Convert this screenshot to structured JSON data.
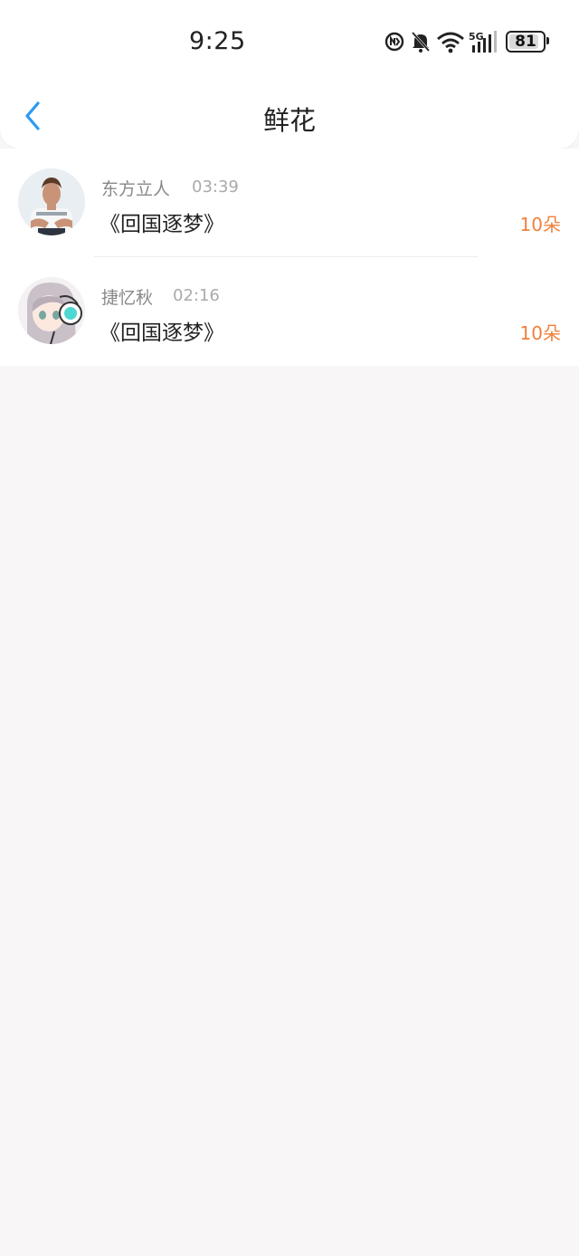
{
  "status": {
    "time": "9:25",
    "battery": "81",
    "network": "5G",
    "icons": [
      "nfc-icon",
      "mute-bell-icon",
      "wifi-icon",
      "signal-icon",
      "battery-icon"
    ]
  },
  "nav": {
    "title": "鲜花",
    "back_icon": "chevron-left-icon"
  },
  "colors": {
    "accent": "#2b9af3",
    "count": "#f0813c",
    "background": "#f8f6f7"
  },
  "items": [
    {
      "name": "东方立人",
      "time": "03:39",
      "title": "《回国逐梦》",
      "count": "10朵"
    },
    {
      "name": "捷忆秋",
      "time": "02:16",
      "title": "《回国逐梦》",
      "count": "10朵"
    }
  ]
}
